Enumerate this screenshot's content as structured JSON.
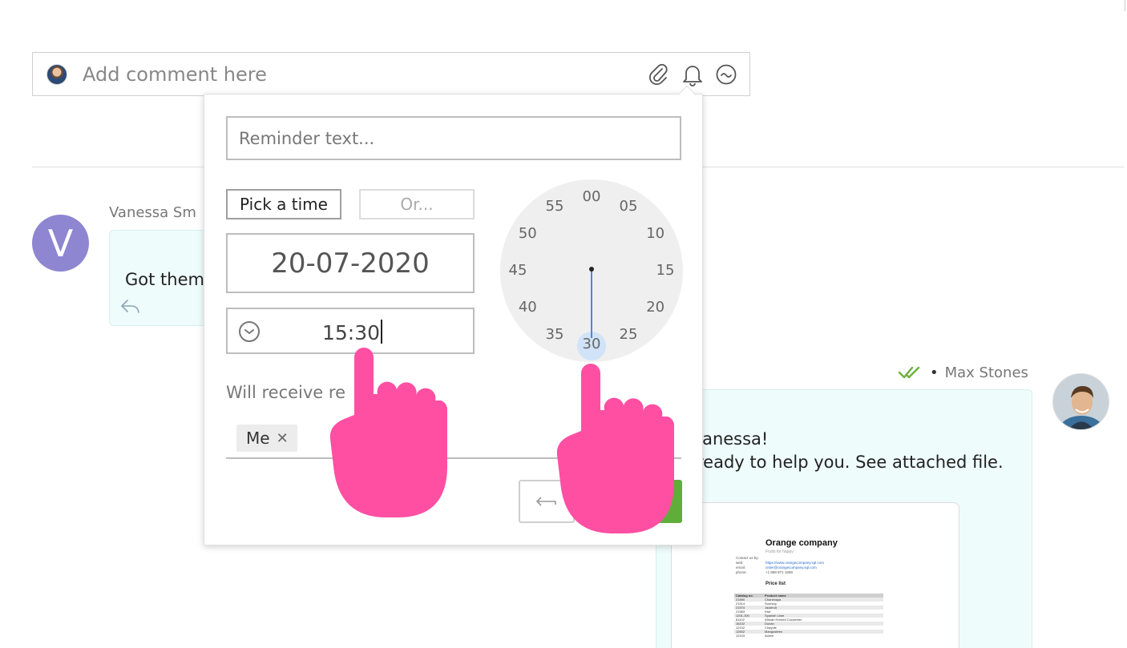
{
  "comment_bar": {
    "placeholder": "Add comment here",
    "icons": [
      "paperclip-icon",
      "bell-icon",
      "smiley-icon"
    ]
  },
  "left_message": {
    "avatar_letter": "V",
    "sender": "Vanessa Sm",
    "text": "Got them"
  },
  "right_message": {
    "status": "read",
    "separator": "•",
    "sender": "Max Stones",
    "line1": "/anessa!",
    "line2": "ready to help you. See attached file.",
    "attachment": {
      "title": "Orange company",
      "subtitle": "Fruits for happy",
      "contacts": [
        {
          "label": "Contact us by:",
          "value": ""
        },
        {
          "label": "web:",
          "value": "https://www.orangecompany.sql.com"
        },
        {
          "label": "email:",
          "value": "order@orangecompany.sql.com"
        },
        {
          "label": "phone:",
          "value": "+1 888 971 1698"
        }
      ],
      "section": "Price list",
      "table_header": [
        "Catalog no.",
        "Product name"
      ],
      "rows": [
        [
          "21890",
          "Chanimaya"
        ],
        [
          "21514",
          "Soursop"
        ],
        [
          "21574",
          "Jackfruit"
        ],
        [
          "21583",
          "Kiwi"
        ],
        [
          "1201-300",
          "Spanish Lime"
        ],
        [
          "81102",
          "African Horned Cucumber"
        ],
        [
          "16102",
          "Durian"
        ],
        [
          "12102",
          "Chayote"
        ],
        [
          "12602",
          "Mangosteen"
        ],
        [
          "12103",
          "Ackee"
        ]
      ]
    }
  },
  "reminder": {
    "text_placeholder": "Reminder text...",
    "pick_time_label": "Pick a time",
    "or_label": "Or...",
    "date": "20-07-2020",
    "time": "15:30",
    "clock_numbers": [
      "00",
      "05",
      "10",
      "15",
      "20",
      "25",
      "30",
      "35",
      "40",
      "45",
      "50",
      "55"
    ],
    "selected_minute": "30",
    "receive_label": "Will receive re",
    "recipients": [
      {
        "name": "Me",
        "remove": "✕"
      }
    ]
  },
  "colors": {
    "accent_blue": "#4f87d9",
    "avatar_purple": "#8e86d1",
    "bubble_bg": "#effcfc",
    "confirm_green": "#5fae3a",
    "read_check_green": "#6bb23a",
    "pointer_pink": "#ff4fa3"
  }
}
